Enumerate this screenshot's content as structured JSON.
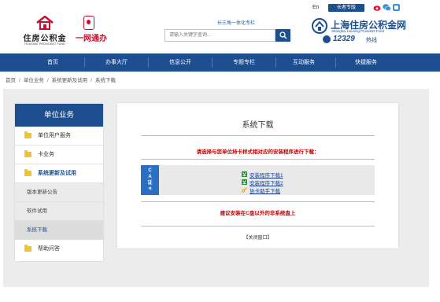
{
  "header": {
    "brand_cn": "住房公积金",
    "brand_en": "HOUSING PROVIDENT FUND",
    "one_net": "一网通办",
    "yrd_column": "长三角一体化专栏",
    "search_placeholder": "请输入关键字查询...",
    "lang": "En",
    "elder_mode": "长者专版",
    "site_cn": "上海住房公积金网",
    "site_en": "Shanghai Housing Provident Fund",
    "hotline_number": "12329",
    "hotline_label": "热线"
  },
  "nav": [
    "首页",
    "办事大厅",
    "信息公开",
    "专题专栏",
    "互动服务",
    "快捷服务"
  ],
  "breadcrumb": [
    "首页",
    "单位业务",
    "系统更新及试用",
    "系统下载"
  ],
  "sidebar": {
    "title": "单位业务",
    "items": [
      {
        "label": "单位用户服务"
      },
      {
        "label": "卡业务"
      },
      {
        "label": "系统更新及试用"
      }
    ],
    "subitems": [
      "版本更新公告",
      "软件试用",
      "系统下载"
    ],
    "last_item": "帮助问答"
  },
  "content": {
    "title": "系统下载",
    "instruction": "请选择与您单位持卡样式相对应的安装程序进行下载：",
    "ca_badge": [
      "C",
      "A",
      "证",
      "书"
    ],
    "downloads": [
      "安装程序下载1",
      "安装程序下载2",
      "协卡助手下载"
    ],
    "note": "建议安装在C盘以外的非系统盘上",
    "close": "【关闭窗口】"
  },
  "colors": {
    "brand_blue": "#1d4e8f",
    "alert_red": "#c00000",
    "ca_blue": "#2a6fc2"
  }
}
